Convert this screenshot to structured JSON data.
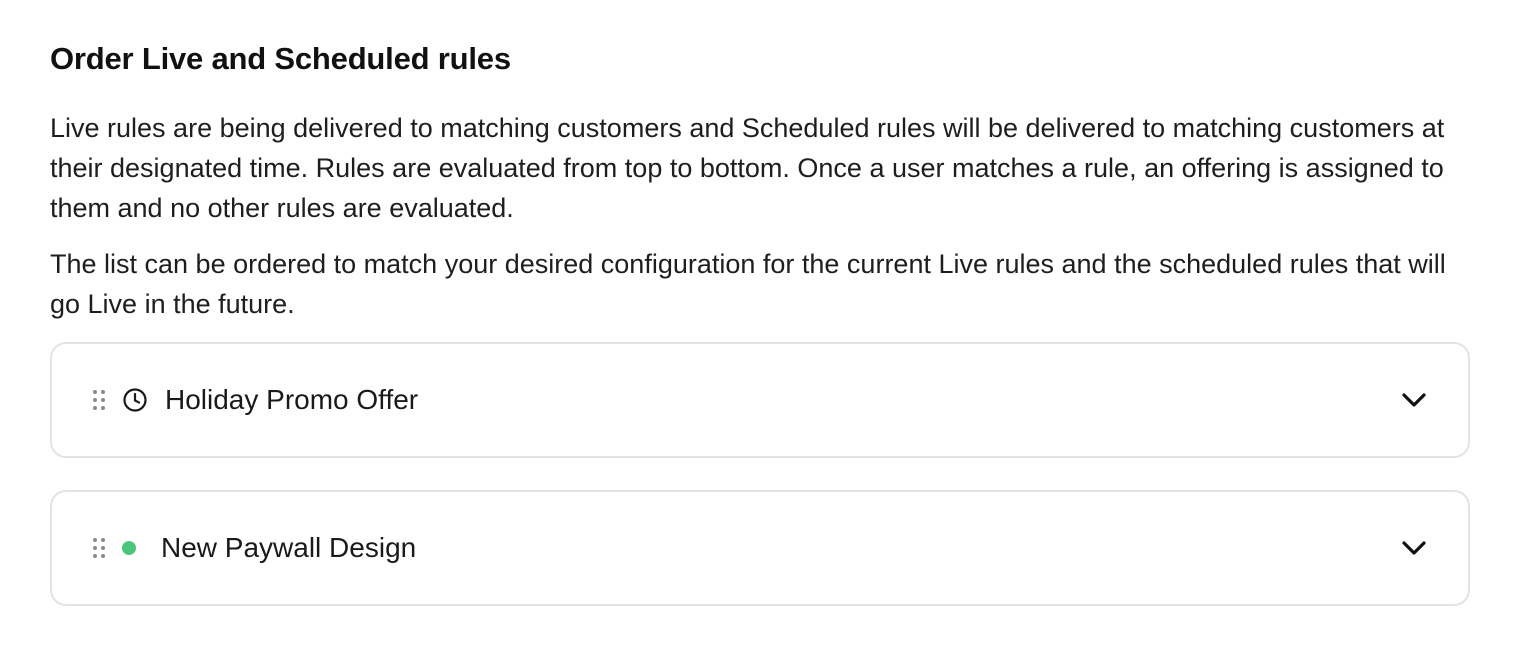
{
  "section": {
    "title": "Order Live and Scheduled rules",
    "description_1": "Live rules are being delivered to matching customers and Scheduled rules will be delivered to matching customers at their designated time. Rules are evaluated from top to bottom. Once a user matches a rule, an offering is assigned to them and no other rules are evaluated.",
    "description_2": "The list can be ordered to match your desired configuration for the current Live rules and the scheduled rules that will go Live in the future."
  },
  "rules": [
    {
      "name": "Holiday Promo Offer",
      "status": "scheduled",
      "status_icon": "clock-icon"
    },
    {
      "name": "New Paywall Design",
      "status": "live",
      "status_icon": "live-status-dot",
      "status_color": "#4cc67a"
    }
  ],
  "icons": {
    "drag": "drag-handle-icon",
    "expand": "chevron-down-icon"
  }
}
